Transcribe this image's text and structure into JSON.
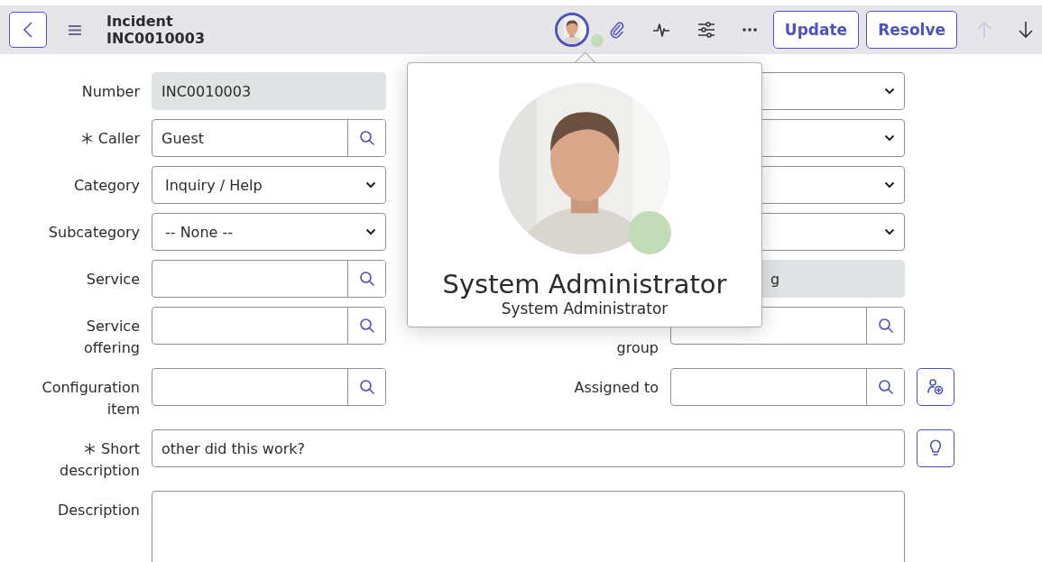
{
  "header": {
    "title": "Incident",
    "number": "INC0010003",
    "actions": [
      "Update",
      "Resolve"
    ],
    "nav": [
      {
        "kind": "up",
        "disabled": true
      },
      {
        "kind": "down",
        "disabled": false
      }
    ]
  },
  "popover": {
    "name": "System Administrator",
    "subtitle": "System Administrator"
  },
  "form": {
    "rows": [
      {
        "left": {
          "label": "Number",
          "kind": "readonly",
          "value": "INC0010003"
        },
        "right": {
          "kind": "select"
        }
      },
      {
        "left": {
          "label": "Caller",
          "mandatory": true,
          "kind": "lookup",
          "value": "Guest"
        },
        "right": {
          "kind": "select"
        }
      },
      {
        "left": {
          "label": "Category",
          "kind": "select",
          "value": "Inquiry / Help"
        },
        "right": {
          "kind": "select"
        }
      },
      {
        "left": {
          "label": "Subcategory",
          "kind": "select",
          "value": "-- None --"
        },
        "right": {
          "kind": "select"
        }
      },
      {
        "left": {
          "label": "Service",
          "kind": "lookup"
        },
        "right": {
          "kind": "readonly",
          "value": "g"
        }
      },
      {
        "left": {
          "label": "Service offering",
          "kind": "lookup"
        },
        "right": {
          "label": "group",
          "kind": "lookup"
        }
      },
      {
        "left": {
          "label": "Configuration item",
          "kind": "lookup"
        },
        "right": {
          "label": "Assigned to",
          "kind": "lookup",
          "action": {
            "kind": "assign"
          }
        }
      },
      {
        "left": {
          "label": "Short description",
          "mandatory": true,
          "kind": "text",
          "value": "other did this work?",
          "action": {
            "kind": "suggest"
          }
        }
      },
      {
        "left": {
          "label": "Description",
          "kind": "textarea"
        }
      }
    ]
  }
}
